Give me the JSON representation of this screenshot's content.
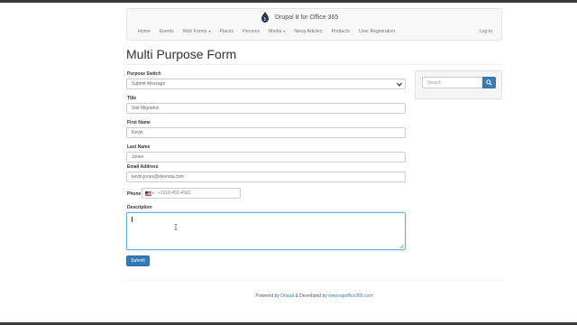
{
  "brand": {
    "title": "Drupal 8 for Office 365"
  },
  "nav": {
    "items": [
      {
        "label": "Home",
        "dropdown": false
      },
      {
        "label": "Events",
        "dropdown": false
      },
      {
        "label": "Web Forms",
        "dropdown": true
      },
      {
        "label": "Places",
        "dropdown": false
      },
      {
        "label": "Persons",
        "dropdown": false
      },
      {
        "label": "Media",
        "dropdown": true
      },
      {
        "label": "News Articles",
        "dropdown": false
      },
      {
        "label": "Products",
        "dropdown": false
      },
      {
        "label": "User Registration",
        "dropdown": false
      }
    ],
    "login": "Log in"
  },
  "page": {
    "title": "Multi Purpose Form"
  },
  "form": {
    "purpose_label": "Purpose Switch",
    "purpose_value": "Submit Message",
    "title_label": "Title",
    "title_value": "Site Migration",
    "first_label": "First Name",
    "first_value": "Kevin",
    "last_label": "Last Name",
    "last_value": "Jones",
    "email_label": "Email Address",
    "email_value": "kevin.jones@devnow.com",
    "phone_label": "Phone",
    "phone_value": "+1918-459-4582",
    "description_label": "Description",
    "submit_label": "Submit"
  },
  "sidebar": {
    "search_placeholder": "Search"
  },
  "footer": {
    "prefix": "Powered by ",
    "drupal": "Drupal",
    "middle": " & Developed by ",
    "link": "www.wpoffice365.com"
  },
  "colors": {
    "primary": "#337ab7",
    "focus": "#66afe9"
  }
}
